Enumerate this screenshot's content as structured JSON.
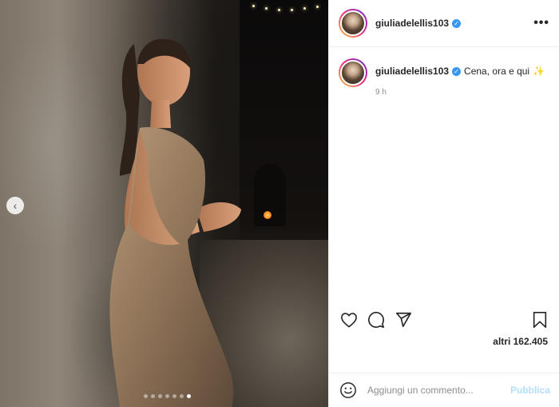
{
  "post": {
    "username": "giuliadelellis103",
    "verified": true,
    "more_icon": "more-horizontal-icon",
    "caption": {
      "username": "giuliadelellis103",
      "text": "Cena, ora e qui",
      "emoji": "sparkles",
      "time": "9 h"
    },
    "likes_text": "altri 162.405",
    "comment": {
      "placeholder": "Aggiungi un commento...",
      "publish_label": "Pubblica"
    },
    "carousel": {
      "total": 7,
      "active_index": 6
    }
  },
  "colors": {
    "text": "#262626",
    "muted": "#8e8e8e",
    "verified": "#3897f0",
    "publish_disabled": "#b2dffc",
    "border": "#efefef"
  }
}
